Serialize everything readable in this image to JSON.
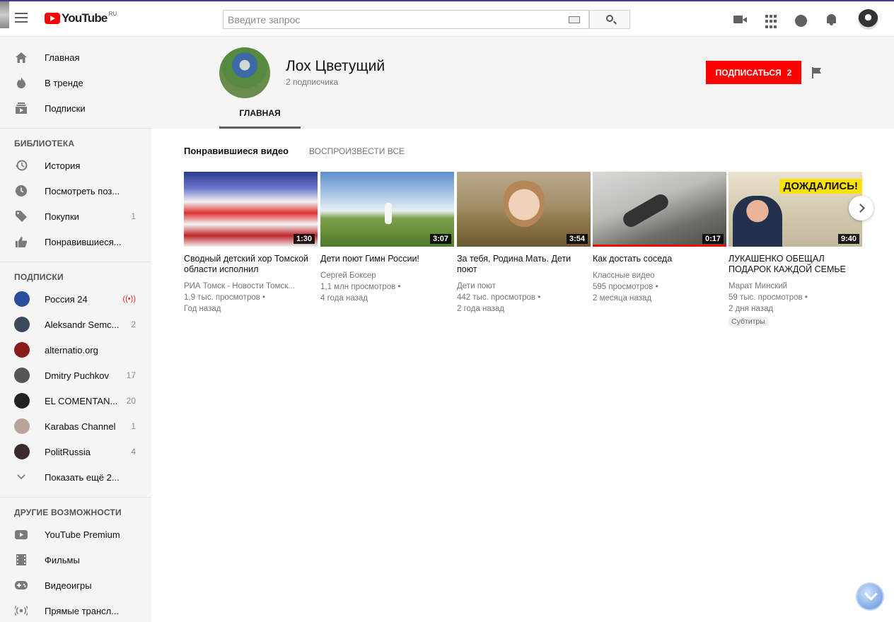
{
  "masthead": {
    "logo_text": "YouTube",
    "logo_region": "RU",
    "search_placeholder": "Введите запрос"
  },
  "sidebar": {
    "primary": [
      {
        "label": "Главная",
        "icon": "home-icon"
      },
      {
        "label": "В тренде",
        "icon": "fire-icon"
      },
      {
        "label": "Подписки",
        "icon": "subscriptions-icon"
      }
    ],
    "library_heading": "БИБЛИОТЕКА",
    "library": [
      {
        "label": "История",
        "icon": "history-icon",
        "count": ""
      },
      {
        "label": "Посмотреть поз...",
        "icon": "clock-icon",
        "count": ""
      },
      {
        "label": "Покупки",
        "icon": "tag-icon",
        "count": "1"
      },
      {
        "label": "Понравившиеся...",
        "icon": "thumbs-up-icon",
        "count": ""
      }
    ],
    "subscriptions_heading": "ПОДПИСКИ",
    "subscriptions": [
      {
        "label": "Россия 24",
        "count": "",
        "live": true,
        "color": "#2a4f9a"
      },
      {
        "label": "Aleksandr Semc...",
        "count": "2",
        "live": false,
        "color": "#3b4a5a"
      },
      {
        "label": "alternatio.org",
        "count": "",
        "live": false,
        "color": "#8b1a1a"
      },
      {
        "label": "Dmitry Puchkov",
        "count": "17",
        "live": false,
        "color": "#555555"
      },
      {
        "label": "EL COMENTAN...",
        "count": "20",
        "live": false,
        "color": "#222222"
      },
      {
        "label": "Karabas Channel",
        "count": "1",
        "live": false,
        "color": "#b9a49a"
      },
      {
        "label": "PolitRussia",
        "count": "4",
        "live": false,
        "color": "#3a2a2a"
      }
    ],
    "show_more": "Показать ещё 2...",
    "other_heading": "ДРУГИЕ ВОЗМОЖНОСТИ",
    "other": [
      {
        "label": "YouTube Premium",
        "icon": "youtube-icon"
      },
      {
        "label": "Фильмы",
        "icon": "film-icon"
      },
      {
        "label": "Видеоигры",
        "icon": "gamepad-icon"
      },
      {
        "label": "Прямые трансл...",
        "icon": "live-icon"
      }
    ]
  },
  "channel": {
    "name": "Лох Цветущий",
    "subscribers": "2 подписчика",
    "subscribe_label": "ПОДПИСАТЬСЯ",
    "subscribe_count": "2",
    "tab_home": "ГЛАВНАЯ"
  },
  "shelf": {
    "title": "Понравившиеся видео",
    "play_all": "ВОСПРОИЗВЕСТИ ВСЕ",
    "videos": [
      {
        "title": "Сводный детский хор Томской области исполнил",
        "channel": "РИА Томск - Новости Томск...",
        "views": "1,9 тыс. просмотров •",
        "age": "Год назад",
        "duration": "1:30",
        "badge": ""
      },
      {
        "title": "Дети поют Гимн России!",
        "channel": "Сергей Боксер",
        "views": "1,1 млн просмотров •",
        "age": "4 года назад",
        "duration": "3:07",
        "badge": ""
      },
      {
        "title": "За тебя, Родина Мать. Дети поют",
        "channel": "Дети поют",
        "views": "442 тыс. просмотров •",
        "age": "2 года назад",
        "duration": "3:54",
        "badge": ""
      },
      {
        "title": "Как достать соседа",
        "channel": "Классные видео",
        "views": "595 просмотров •",
        "age": "2 месяца назад",
        "duration": "0:17",
        "badge": ""
      },
      {
        "title": "ЛУКАШЕНКО ОБЕЩАЛ ПОДАРОК КАЖДОЙ СЕМЬЕ",
        "channel": "Марат Минский",
        "views": "59 тыс. просмотров •",
        "age": "2 дня назад",
        "duration": "9:40",
        "badge": "Субтитры",
        "thumb_text": "ДОЖДАЛИСЬ!"
      }
    ]
  },
  "colors": {
    "accent": "#ff0000",
    "sidebar_bg": "#f5f5f5"
  }
}
